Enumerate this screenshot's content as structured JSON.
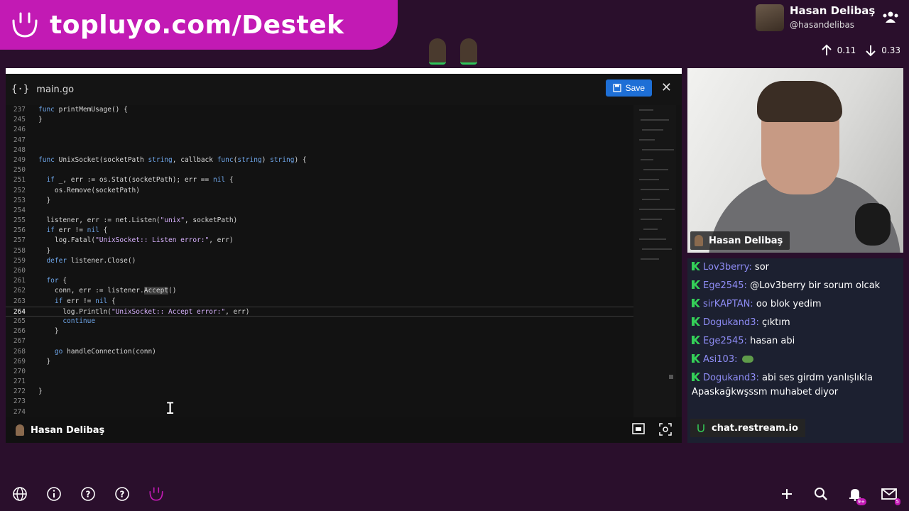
{
  "banner": {
    "title": "topluyo.com/Destek",
    "accent": "#c21ab4"
  },
  "user": {
    "name": "Hasan Delibaş",
    "handle": "@hasandelibas"
  },
  "stats": {
    "up": "0.11",
    "down": "0.33"
  },
  "editor": {
    "filename": "main.go",
    "save_label": "Save",
    "footer_name": "Hasan Delibaş",
    "lines": [
      {
        "n": "237",
        "t": "func printMemUsage() {"
      },
      {
        "n": "245",
        "t": "}"
      },
      {
        "n": "246",
        "t": ""
      },
      {
        "n": "247",
        "t": ""
      },
      {
        "n": "248",
        "t": ""
      },
      {
        "n": "249",
        "t": "func UnixSocket(socketPath string, callback func(string) string) {"
      },
      {
        "n": "250",
        "t": ""
      },
      {
        "n": "251",
        "t": "  if _, err := os.Stat(socketPath); err == nil {"
      },
      {
        "n": "252",
        "t": "    os.Remove(socketPath)"
      },
      {
        "n": "253",
        "t": "  }"
      },
      {
        "n": "254",
        "t": ""
      },
      {
        "n": "255",
        "t": "  listener, err := net.Listen(\"unix\", socketPath)"
      },
      {
        "n": "256",
        "t": "  if err != nil {"
      },
      {
        "n": "257",
        "t": "    log.Fatal(\"UnixSocket:: Listen error:\", err)"
      },
      {
        "n": "258",
        "t": "  }"
      },
      {
        "n": "259",
        "t": "  defer listener.Close()"
      },
      {
        "n": "260",
        "t": ""
      },
      {
        "n": "261",
        "t": "  for {"
      },
      {
        "n": "262",
        "t": "    conn, err := listener.Accept()"
      },
      {
        "n": "263",
        "t": "    if err != nil {"
      },
      {
        "n": "264",
        "t": "      log.Println(\"UnixSocket:: Accept error:\", err)"
      },
      {
        "n": "265",
        "t": "      continue"
      },
      {
        "n": "266",
        "t": "    }"
      },
      {
        "n": "267",
        "t": ""
      },
      {
        "n": "268",
        "t": "    go handleConnection(conn)"
      },
      {
        "n": "269",
        "t": "  }"
      },
      {
        "n": "270",
        "t": ""
      },
      {
        "n": "271",
        "t": ""
      },
      {
        "n": "272",
        "t": "}"
      },
      {
        "n": "273",
        "t": ""
      },
      {
        "n": "274",
        "t": ""
      }
    ],
    "active_line": "264"
  },
  "webcam": {
    "label": "Hasan Delibaş"
  },
  "chat": {
    "messages": [
      {
        "user": "Lov3berry:",
        "text": "sor"
      },
      {
        "user": "Ege2545:",
        "text": "@Lov3berry bir sorum olcak"
      },
      {
        "user": "sirKAPTAN:",
        "text": "oo blok yedim"
      },
      {
        "user": "Dogukand3:",
        "text": "çıktım"
      },
      {
        "user": "Ege2545:",
        "text": "hasan abi"
      },
      {
        "user": "Asi103:",
        "text": ""
      },
      {
        "user": "Dogukand3:",
        "text": "abi ses girdm yanlışlıkla Apaskağkwşssm muhabet diyor"
      }
    ],
    "source": "chat.restream.io",
    "user_color": "#8e8cf5",
    "platform_color": "#34d058"
  },
  "notifications_badge": "9+",
  "mail_badge": "5"
}
